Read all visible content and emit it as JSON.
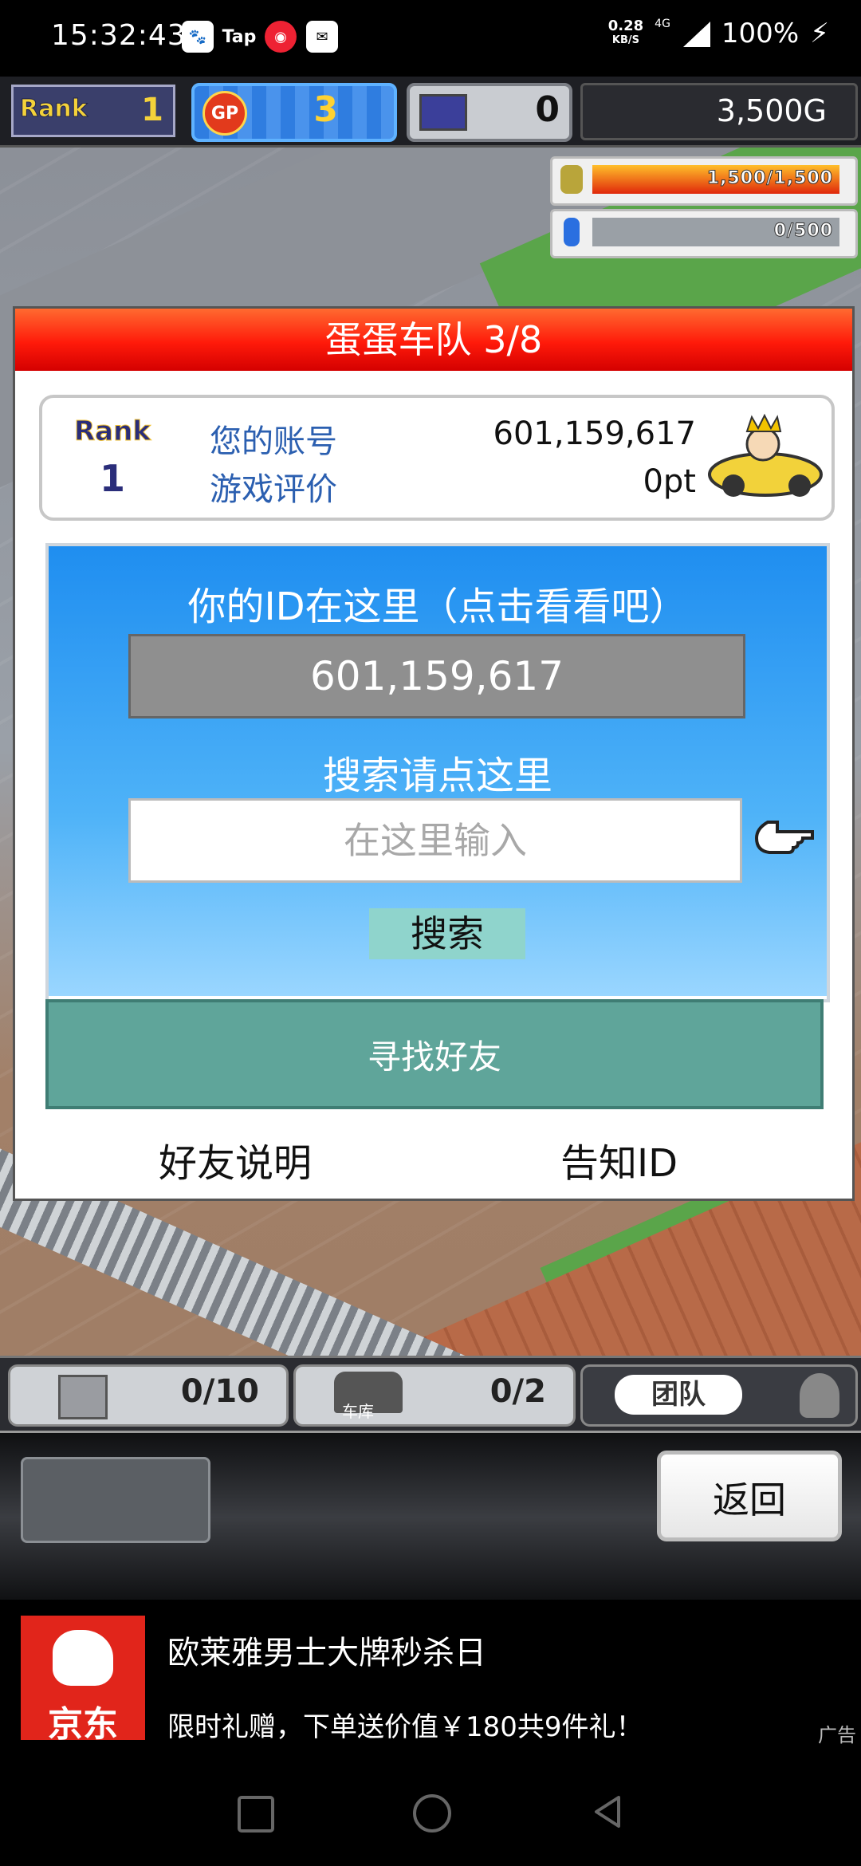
{
  "status_bar": {
    "time": "15:32:43",
    "app_icons": [
      "baidu-icon",
      "tap-icon",
      "netease-music-icon",
      "mail-icon"
    ],
    "tap_label": "Tap",
    "net_speed": "0.28",
    "net_unit": "KB/S",
    "network": "4G",
    "battery": "100%"
  },
  "hud": {
    "rank_label": "Rank",
    "rank_value": "1",
    "gp_label": "GP",
    "gp_value": "3",
    "pc_value": "0",
    "gold": "3,500G",
    "bar1_text": "1,500/1,500",
    "bar1_fraction": 1.0,
    "bar2_text": "0/500",
    "bar2_fraction": 0.0
  },
  "dialog": {
    "title": "蛋蛋车队 3/8",
    "rank_label": "Rank",
    "rank_value": "1",
    "account_label": "您的账号",
    "account_value": "601,159,617",
    "rating_label": "游戏评价",
    "rating_value": "0pt",
    "id_prompt": "你的ID在这里（点击看看吧）",
    "id_value": "601,159,617",
    "search_prompt": "搜索请点这里",
    "search_placeholder": "在这里输入",
    "search_button": "搜索",
    "find_friends": "寻找好友",
    "friend_help": "好友说明",
    "tell_id": "告知ID"
  },
  "game_menu": {
    "box_count": "0/10",
    "garage_label": "车库",
    "garage_count": "0/2",
    "team_label": "团队"
  },
  "nav": {
    "back_label": "返回"
  },
  "ad": {
    "brand": "京东",
    "title": "欧莱雅男士大牌秒杀日",
    "subtitle": "限时礼赠，下单送价值￥180共9件礼！",
    "tag": "广告"
  },
  "colors": {
    "dialog_header": "#ff1a0a",
    "blue_panel": "#1f8ef0",
    "find_button": "#5fa59a",
    "ad_brand": "#e1251b"
  }
}
